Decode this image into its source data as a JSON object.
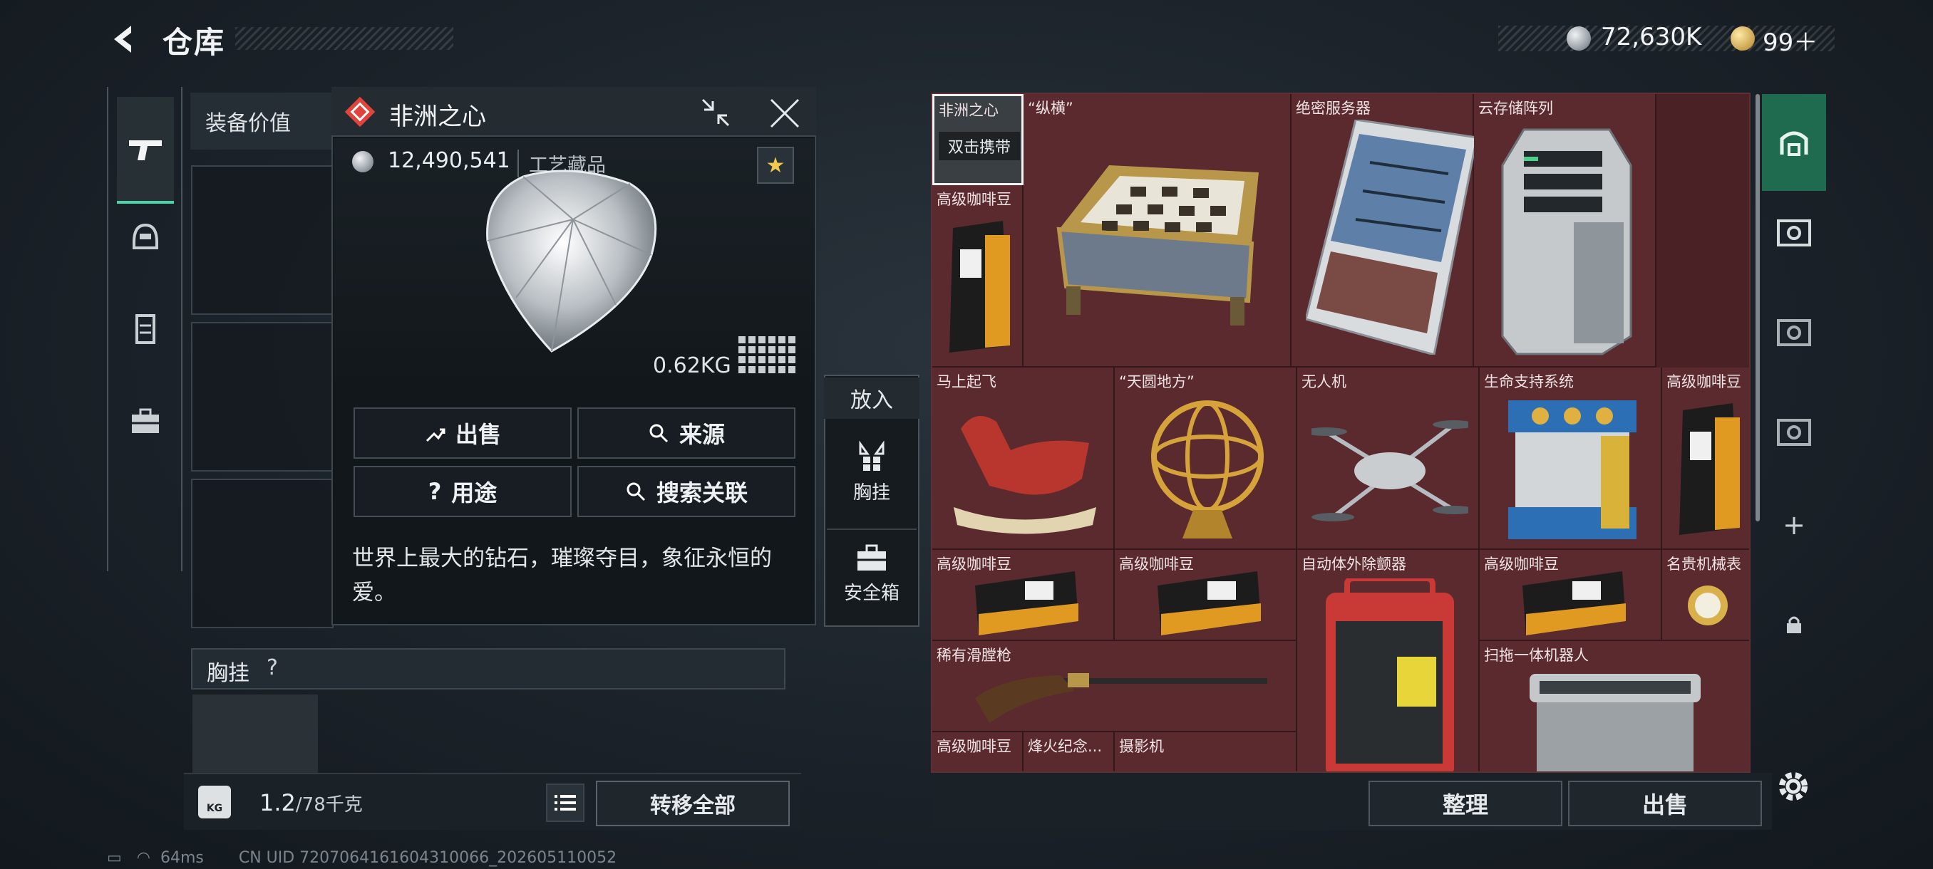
{
  "header": {
    "title": "仓库",
    "currency_main": "72,630K",
    "currency_secondary": "99＋"
  },
  "left": {
    "equip_value_label": "装备价值",
    "chest_rig_label": "胸挂",
    "help": "?",
    "weight_current": "1.2",
    "weight_max": "/78千克",
    "kg": "KG",
    "transfer_all": "转移全部"
  },
  "popup": {
    "title": "非洲之心",
    "price": "12,490,541",
    "category": "工艺藏品",
    "weight": "0.62KG",
    "buttons": {
      "sell": "出售",
      "source": "来源",
      "usage": "用途",
      "search_related": "搜索关联"
    },
    "description": "世界上最大的钻石，璀璨夺目，象征永恒的爱。"
  },
  "put": {
    "label": "放入",
    "chest_rig": "胸挂",
    "safe_box": "安全箱"
  },
  "grid": {
    "items": [
      {
        "name": "非洲之心",
        "tag": "双击携带"
      },
      {
        "name": "“纵横”"
      },
      {
        "name": "绝密服务器"
      },
      {
        "name": "云存储阵列"
      },
      {
        "name": "高级咖啡豆"
      },
      {
        "name": "马上起飞"
      },
      {
        "name": "“天圆地方”"
      },
      {
        "name": "无人机"
      },
      {
        "name": "生命支持系统"
      },
      {
        "name": "高级咖啡豆"
      },
      {
        "name": "高级咖啡豆"
      },
      {
        "name": "高级咖啡豆"
      },
      {
        "name": "自动体外除颤器"
      },
      {
        "name": "高级咖啡豆"
      },
      {
        "name": "名贵机械表"
      },
      {
        "name": "稀有滑膛枪"
      },
      {
        "name": "扫拖一体机器人"
      },
      {
        "name": "高级咖啡豆"
      },
      {
        "name": "烽火纪念..."
      },
      {
        "name": "摄影机"
      }
    ],
    "sort": "整理",
    "sell": "出售"
  },
  "status": {
    "ping": "64ms",
    "uid": "CN UID 7207064161604310066_202605110052"
  },
  "colors": {
    "accent_green": "#4fd0a5",
    "grid_bg": "#5a2a2f",
    "active_tab": "#1e6b50"
  }
}
